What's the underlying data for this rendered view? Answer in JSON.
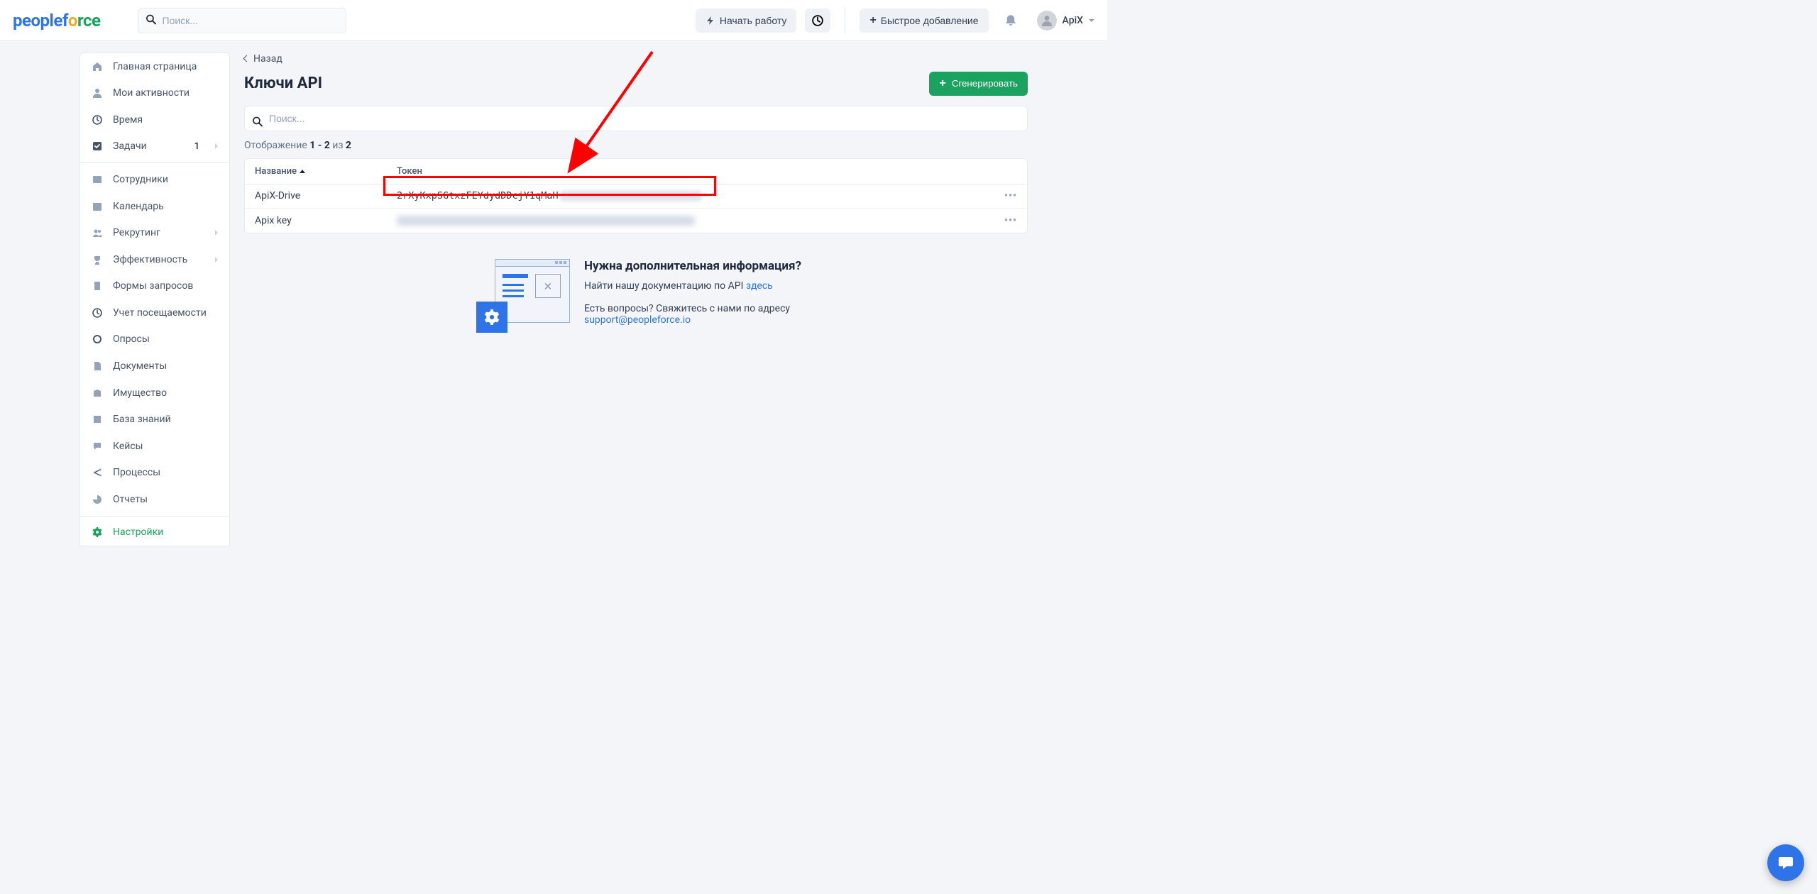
{
  "header": {
    "logo_text_people": "people",
    "logo_text_f": "f",
    "logo_text_o": "o",
    "logo_text_rce": "rce",
    "search_placeholder": "Поиск...",
    "start_label": "Начать работу",
    "quick_add_label": "Быстрое добавление",
    "user_name": "ApiX"
  },
  "sidebar": {
    "items": [
      {
        "label": "Главная страница",
        "icon": "home"
      },
      {
        "label": "Мои активности",
        "icon": "user"
      },
      {
        "label": "Время",
        "icon": "clock"
      },
      {
        "label": "Задачи",
        "icon": "check",
        "badge": "1",
        "chev": true
      }
    ],
    "items2": [
      {
        "label": "Сотрудники",
        "icon": "idcard"
      },
      {
        "label": "Календарь",
        "icon": "calendar"
      },
      {
        "label": "Рекрутинг",
        "icon": "users",
        "chev": true
      },
      {
        "label": "Эффективность",
        "icon": "trophy",
        "chev": true
      },
      {
        "label": "Формы запросов",
        "icon": "clipboard"
      },
      {
        "label": "Учет посещаемости",
        "icon": "clock"
      },
      {
        "label": "Опросы",
        "icon": "circle"
      },
      {
        "label": "Документы",
        "icon": "file"
      },
      {
        "label": "Имущество",
        "icon": "box"
      },
      {
        "label": "База знаний",
        "icon": "book"
      },
      {
        "label": "Кейсы",
        "icon": "chat"
      },
      {
        "label": "Процессы",
        "icon": "share"
      },
      {
        "label": "Отчеты",
        "icon": "pie"
      }
    ],
    "settings_label": "Настройки"
  },
  "main": {
    "back_label": "Назад",
    "title": "Ключи API",
    "generate_btn": "Сгенерировать",
    "filter_placeholder": "Поиск...",
    "count_prefix": "Отображение ",
    "count_range": "1 - 2",
    "count_mid": " из ",
    "count_total": "2",
    "col_name": "Название",
    "col_token": "Токен",
    "rows": [
      {
        "name": "ApiX-Drive",
        "token": "2rXyKxpSGtxzFEYdydDDcjY1qMaH"
      },
      {
        "name": "Apix key",
        "token": ""
      }
    ]
  },
  "info": {
    "title": "Нужна дополнительная информация?",
    "doc_text": "Найти нашу документацию по API ",
    "doc_link": "здесь",
    "contact_text": "Есть вопросы? Свяжитесь с нами по адресу ",
    "contact_email": "support@peopleforce.io"
  }
}
